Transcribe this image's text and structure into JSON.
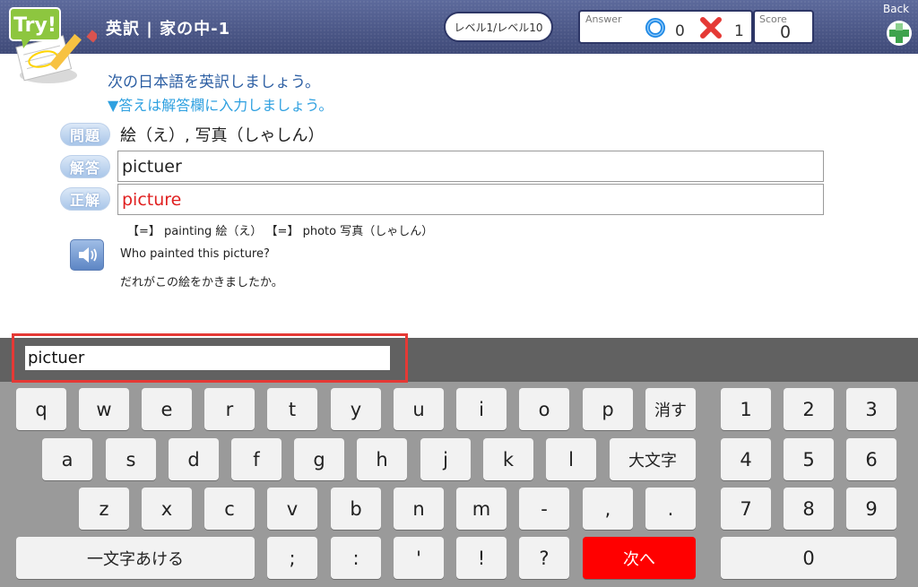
{
  "header": {
    "title": "英訳 | 家の中-1",
    "level": "レベル1/レベル10",
    "answer_label": "Answer",
    "correct_count": "0",
    "wrong_count": "1",
    "score_label": "Score",
    "score_value": "0",
    "back_label": "Back",
    "logo_text": "Try!"
  },
  "question": {
    "instruction": "次の日本語を英訳しましょう。",
    "hint": "▼答えは解答欄に入力しましょう。",
    "tag_problem": "問題",
    "tag_answer": "解答",
    "tag_correct": "正解",
    "problem_text": "絵（え）, 写真（しゃしん）",
    "answer_text": "pictuer",
    "correct_text": "picture",
    "synonyms": "【=】 painting 絵（え） 【=】 photo 写真（しゃしん）",
    "example_en": "Who painted this picture?",
    "example_ja": "だれがこの絵をかきましたか。"
  },
  "keyboard": {
    "input_value": "pictuer",
    "row1": [
      "q",
      "w",
      "e",
      "r",
      "t",
      "y",
      "u",
      "i",
      "o",
      "p"
    ],
    "delete": "消す",
    "row2": [
      "a",
      "s",
      "d",
      "f",
      "g",
      "h",
      "j",
      "k",
      "l"
    ],
    "caps": "大文字",
    "row3": [
      "z",
      "x",
      "c",
      "v",
      "b",
      "n",
      "m",
      "-",
      ",",
      "."
    ],
    "space": "一文字あける",
    "row4": [
      ";",
      ":",
      "'",
      "!",
      "?"
    ],
    "next": "次へ",
    "numpad": [
      "1",
      "2",
      "3",
      "4",
      "5",
      "6",
      "7",
      "8",
      "9",
      "0"
    ]
  },
  "colors": {
    "accent_red": "#ff0000",
    "header_blue": "#4a5585",
    "correct_text_red": "#e02020"
  }
}
